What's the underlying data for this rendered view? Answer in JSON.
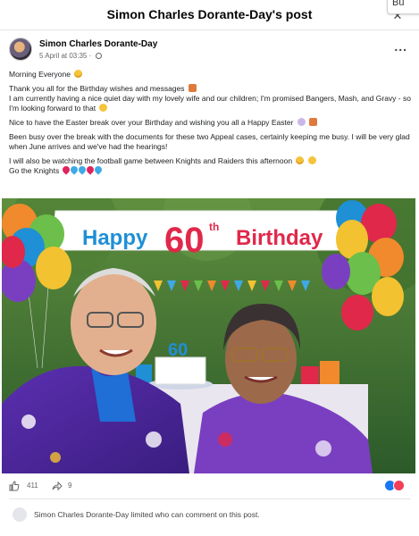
{
  "header": {
    "title": "Simon Charles Dorante-Day's post",
    "close_icon": "close-icon",
    "tooltip_text": "Bu"
  },
  "post": {
    "author": "Simon Charles Dorante-Day",
    "timestamp": "5 April at 03:35",
    "audience_icon": "globe-icon",
    "more_icon": "more-options-icon",
    "more_label": "...",
    "paragraphs": [
      "Morning Everyone",
      "Thank you all for the Birthday wishes and messages",
      "I am currently having a nice quiet day with my lovely wife and our children; I'm promised Bangers, Mash, and Gravy - so I'm looking forward to that",
      "Nice to have the Easter break over your Birthday and wishing you all a Happy Easter",
      "Been busy over the break with the documents for these two Appeal cases, certainly keeping me busy. I will be very glad when June arrives and we've had the hearings!",
      "I will also be watching the football game between Knights and Raiders this afternoon",
      "Go the Knights"
    ],
    "heart_colors": [
      "#e0245e",
      "#3fa9e6",
      "#3fa9e6",
      "#e0245e",
      "#3fa9e6"
    ]
  },
  "photo": {
    "banner_text_1": "Happy",
    "banner_text_2": "60",
    "banner_text_3": "th",
    "banner_text_4": "Birthday",
    "cake_number": "60"
  },
  "engagement": {
    "like_icon": "like-icon",
    "likes": "411",
    "share_icon": "share-icon",
    "shares": "9",
    "reaction_colors": [
      "#1877f2",
      "#f33e58"
    ]
  },
  "footer": {
    "notice": "Simon Charles Dorante-Day limited who can comment on this post."
  }
}
